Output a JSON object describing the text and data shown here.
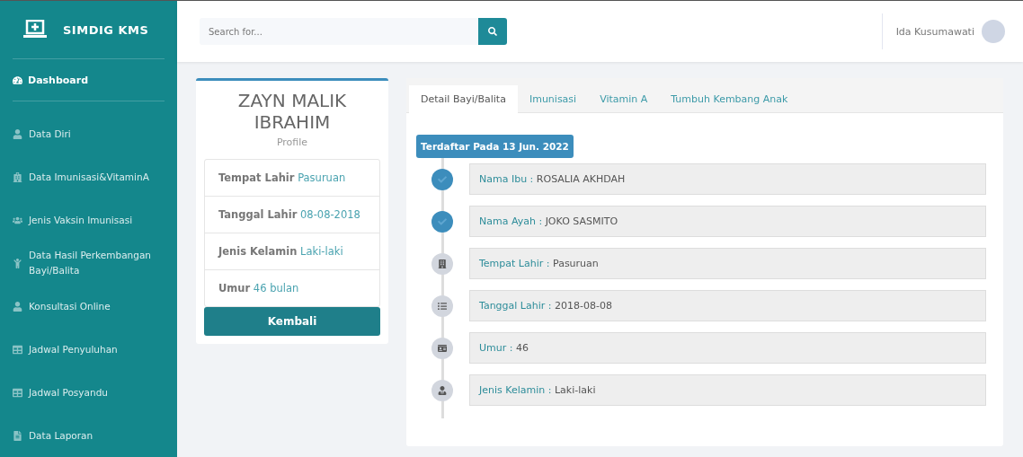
{
  "brand": {
    "title": "SIMDIG KMS"
  },
  "sidebar": {
    "dashboard": {
      "label": "Dashboard"
    },
    "items": [
      {
        "label": "Data Diri",
        "kind": "person"
      },
      {
        "label": "Data Imunisasi&VitaminA",
        "kind": "building"
      },
      {
        "label": "Jenis Vaksin Imunisasi",
        "kind": "group"
      },
      {
        "label": "Data Hasil Perkembangan Bayi/Balita",
        "kind": "child"
      },
      {
        "label": "Konsultasi Online",
        "kind": "person"
      },
      {
        "label": "Jadwal Penyuluhan",
        "kind": "table"
      },
      {
        "label": "Jadwal Posyandu",
        "kind": "table"
      },
      {
        "label": "Data Laporan",
        "kind": "file"
      }
    ]
  },
  "topbar": {
    "search": {
      "placeholder": "Search for..."
    },
    "user": {
      "name": "Ida Kusumawati"
    }
  },
  "profile": {
    "name": "ZAYN MALIK IBRAHIM",
    "subtitle": "Profile",
    "facts": [
      {
        "label": "Tempat Lahir",
        "value": "Pasuruan"
      },
      {
        "label": "Tanggal Lahir",
        "value": "08-08-2018"
      },
      {
        "label": "Jenis Kelamin",
        "value": "Laki-laki"
      },
      {
        "label": "Umur",
        "value": "46 bulan"
      }
    ],
    "button": "Kembali"
  },
  "tabs": [
    {
      "label": "Detail Bayi/Balita",
      "selected": true
    },
    {
      "label": "Imunisasi",
      "selected": false
    },
    {
      "label": "Vitamin A",
      "selected": false
    },
    {
      "label": "Tumbuh Kembang Anak",
      "selected": false
    }
  ],
  "timeline": {
    "header": "Terdaftar Pada 13 Jun. 2022",
    "items": [
      {
        "label": "Nama Ibu :",
        "value": "ROSALIA AKHDAH",
        "kind": "check"
      },
      {
        "label": "Nama Ayah :",
        "value": "JOKO SASMITO",
        "kind": "check"
      },
      {
        "label": "Tempat Lahir :",
        "value": "Pasuruan",
        "kind": "building"
      },
      {
        "label": "Tanggal Lahir :",
        "value": "2018-08-08",
        "kind": "list"
      },
      {
        "label": "Umur :",
        "value": "46",
        "kind": "card"
      },
      {
        "label": "Jenis Kelamin :",
        "value": "Laki-laki",
        "kind": "person"
      }
    ]
  }
}
